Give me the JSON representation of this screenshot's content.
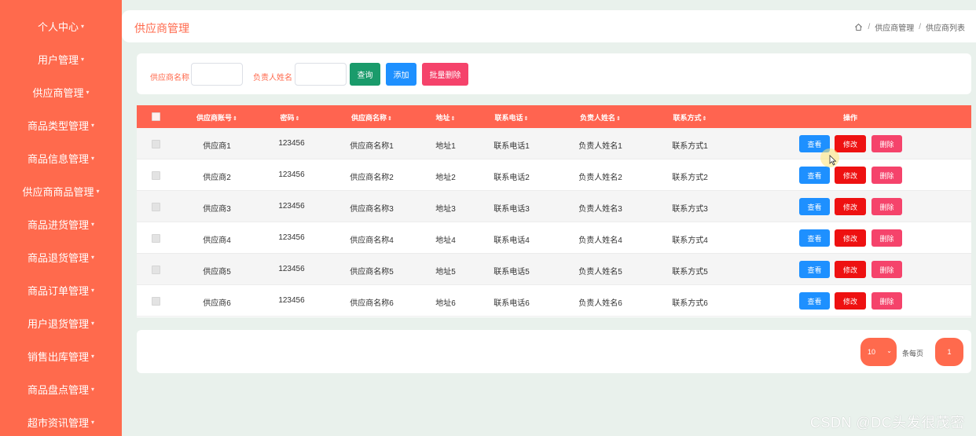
{
  "sidebar": {
    "items": [
      {
        "label": "个人中心"
      },
      {
        "label": "用户管理"
      },
      {
        "label": "供应商管理"
      },
      {
        "label": "商品类型管理"
      },
      {
        "label": "商品信息管理"
      },
      {
        "label": "供应商商品管理"
      },
      {
        "label": "商品进货管理"
      },
      {
        "label": "商品退货管理"
      },
      {
        "label": "商品订单管理"
      },
      {
        "label": "用户退货管理"
      },
      {
        "label": "销售出库管理"
      },
      {
        "label": "商品盘点管理"
      },
      {
        "label": "超市资讯管理"
      }
    ]
  },
  "header": {
    "title": "供应商管理",
    "breadcrumb": [
      "供应商管理",
      "供应商列表"
    ]
  },
  "search": {
    "supplier_name_label": "供应商名称",
    "contact_name_label": "负责人姓名",
    "query_button": "查询",
    "add_button": "添加",
    "batch_delete_button": "批量删除"
  },
  "table": {
    "columns": [
      "供应商账号",
      "密码",
      "供应商名称",
      "地址",
      "联系电话",
      "负责人姓名",
      "联系方式",
      "操作"
    ],
    "rows": [
      [
        "供应商1",
        "123456",
        "供应商名称1",
        "地址1",
        "联系电话1",
        "负责人姓名1",
        "联系方式1"
      ],
      [
        "供应商2",
        "123456",
        "供应商名称2",
        "地址2",
        "联系电话2",
        "负责人姓名2",
        "联系方式2"
      ],
      [
        "供应商3",
        "123456",
        "供应商名称3",
        "地址3",
        "联系电话3",
        "负责人姓名3",
        "联系方式3"
      ],
      [
        "供应商4",
        "123456",
        "供应商名称4",
        "地址4",
        "联系电话4",
        "负责人姓名4",
        "联系方式4"
      ],
      [
        "供应商5",
        "123456",
        "供应商名称5",
        "地址5",
        "联系电话5",
        "负责人姓名5",
        "联系方式5"
      ],
      [
        "供应商6",
        "123456",
        "供应商名称6",
        "地址6",
        "联系电话6",
        "负责人姓名6",
        "联系方式6"
      ]
    ],
    "actions": {
      "view": "查看",
      "edit": "修改",
      "delete": "删除"
    }
  },
  "pagination": {
    "page_size": "10",
    "per_page_label": "条每页",
    "current_page": "1"
  },
  "watermark": "CSDN @DC头发很茂密",
  "colors": {
    "sidebar": "#ff6a4d",
    "table_header": "#ff6450",
    "query_button": "#1a9b6b",
    "view_button": "#1e90ff",
    "edit_button": "#ee1111",
    "delete_button": "#f5436b"
  }
}
